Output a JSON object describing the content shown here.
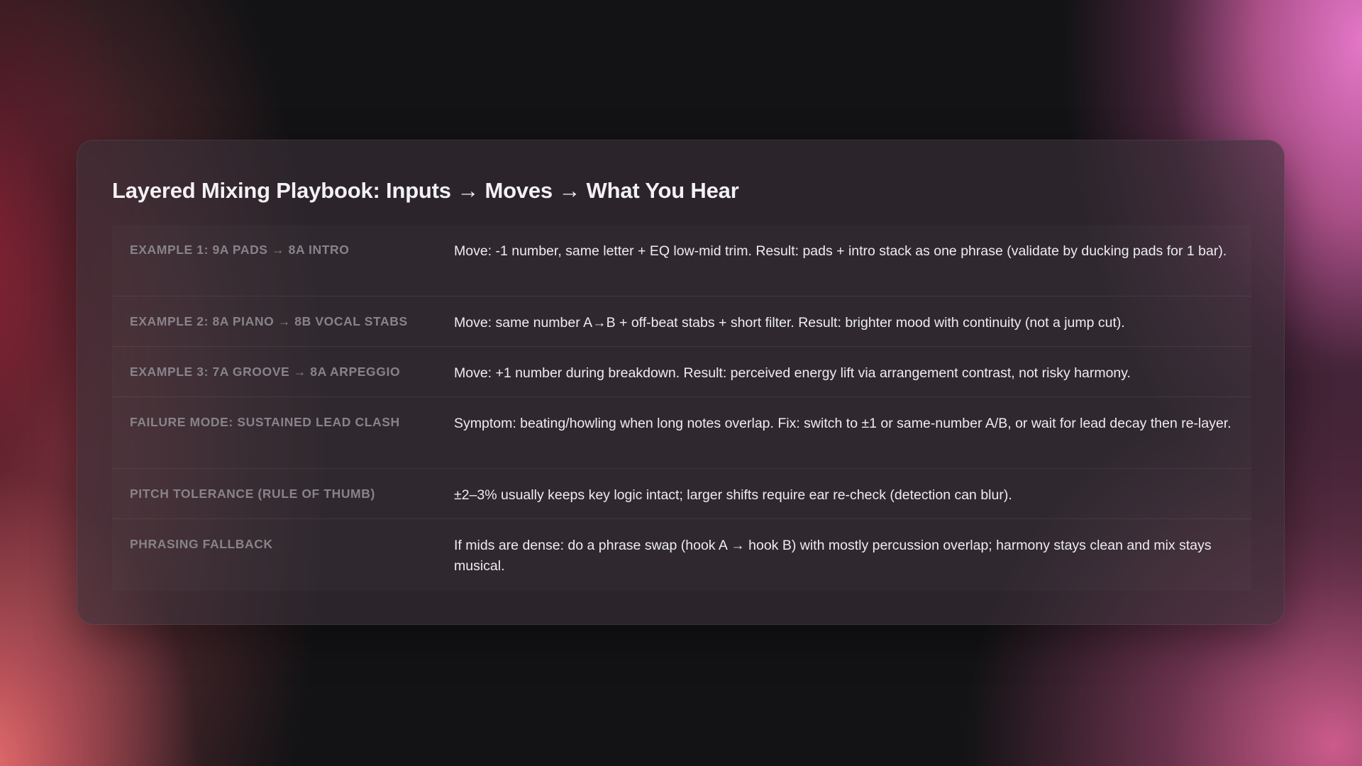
{
  "title": "Layered Mixing Playbook: Inputs → Moves → What You Hear",
  "rows": [
    {
      "label": "Example 1: 9A pads → 8A intro",
      "value": "Move: -1 number, same letter + EQ low-mid trim. Result: pads + intro stack as one phrase (validate by ducking pads for 1 bar)."
    },
    {
      "label": "Example 2: 8A piano → 8B vocal stabs",
      "value": "Move: same number A→B + off-beat stabs + short filter. Result: brighter mood with continuity (not a jump cut)."
    },
    {
      "label": "Example 3: 7A groove → 8A arpeggio",
      "value": "Move: +1 number during breakdown. Result: perceived energy lift via arrangement contrast, not risky harmony."
    },
    {
      "label": "Failure mode: sustained lead clash",
      "value": "Symptom: beating/howling when long notes overlap. Fix: switch to ±1 or same-number A/B, or wait for lead decay then re-layer."
    },
    {
      "label": "Pitch tolerance (rule of thumb)",
      "value": "±2–3% usually keeps key logic intact; larger shifts require ear re-check (detection can blur)."
    },
    {
      "label": "Phrasing fallback",
      "value": "If mids are dense: do a phrase swap (hook A → hook B) with mostly percussion overlap; harmony stays clean and mix stays musical."
    }
  ]
}
